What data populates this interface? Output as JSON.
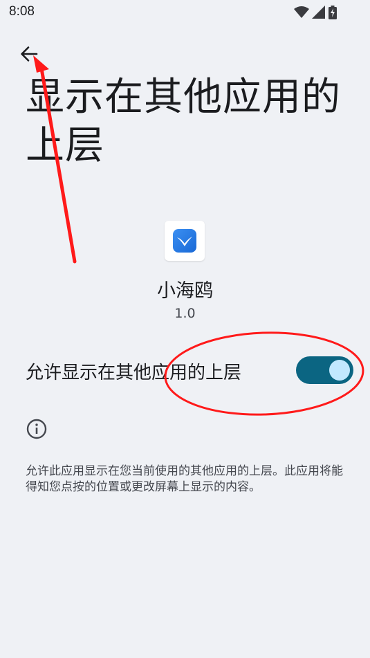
{
  "status_bar": {
    "time": "8:08",
    "icons": [
      "wifi-icon",
      "signal-icon",
      "battery-charging-icon"
    ]
  },
  "header": {
    "back_icon": "arrow-back-icon",
    "title": "显示在其他应用的上层"
  },
  "app": {
    "name": "小海鸥",
    "version": "1.0",
    "icon": "seagull-app-icon"
  },
  "permission": {
    "label": "允许显示在其他应用的上层",
    "enabled": true
  },
  "info": {
    "icon": "info-icon",
    "description": "允许此应用显示在您当前使用的其他应用的上层。此应用将能得知您点按的位置或更改屏幕上显示的内容。"
  },
  "colors": {
    "background": "#eff1f5",
    "toggle_track": "#0b6582",
    "toggle_thumb": "#c2e8ff",
    "annotation": "#ff0000"
  }
}
